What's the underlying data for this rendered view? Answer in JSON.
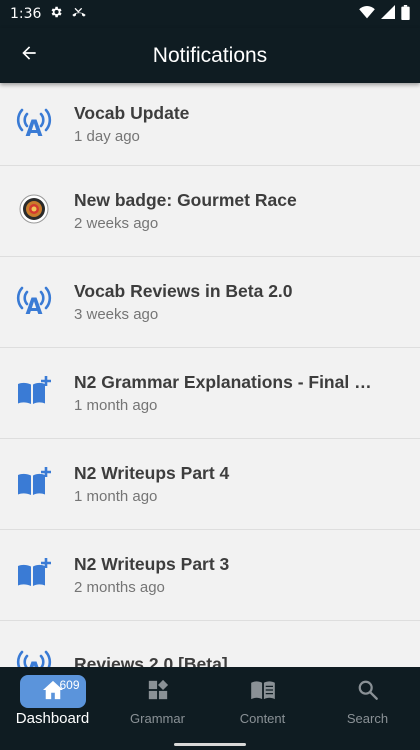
{
  "status_bar": {
    "time": "1:36",
    "icons": [
      "settings-gear-icon",
      "missed-call-icon",
      "wifi-icon",
      "signal-icon",
      "battery-icon"
    ]
  },
  "app_bar": {
    "title": "Notifications",
    "back_icon": "arrow-back-icon"
  },
  "notifications": [
    {
      "title": "Vocab Update",
      "time": "1 day ago",
      "icon": "broadcast-a-icon"
    },
    {
      "title": "New badge: Gourmet Race",
      "time": "2 weeks ago",
      "icon": "badge-medal-icon"
    },
    {
      "title": "Vocab Reviews in Beta 2.0",
      "time": "3 weeks ago",
      "icon": "broadcast-a-icon"
    },
    {
      "title": "N2 Grammar Explanations - Final …",
      "time": "1 month ago",
      "icon": "book-plus-icon"
    },
    {
      "title": "N2 Writeups Part 4",
      "time": "1 month ago",
      "icon": "book-plus-icon"
    },
    {
      "title": "N2 Writeups Part 3",
      "time": "2 months ago",
      "icon": "book-plus-icon"
    },
    {
      "title": "Reviews 2.0 [Beta]",
      "time": "",
      "icon": "broadcast-a-icon"
    }
  ],
  "bottom_nav": {
    "items": [
      {
        "label": "Dashboard",
        "icon": "home-icon",
        "badge": "609",
        "active": true
      },
      {
        "label": "Grammar",
        "icon": "grammar-blocks-icon",
        "active": false
      },
      {
        "label": "Content",
        "icon": "open-book-icon",
        "active": false
      },
      {
        "label": "Search",
        "icon": "search-icon",
        "active": false
      }
    ]
  },
  "colors": {
    "dark_bar": "#0f1c22",
    "accent_blue": "#3a7bd5",
    "list_bg": "#f2f2f2",
    "active_pill": "#5b94db"
  }
}
